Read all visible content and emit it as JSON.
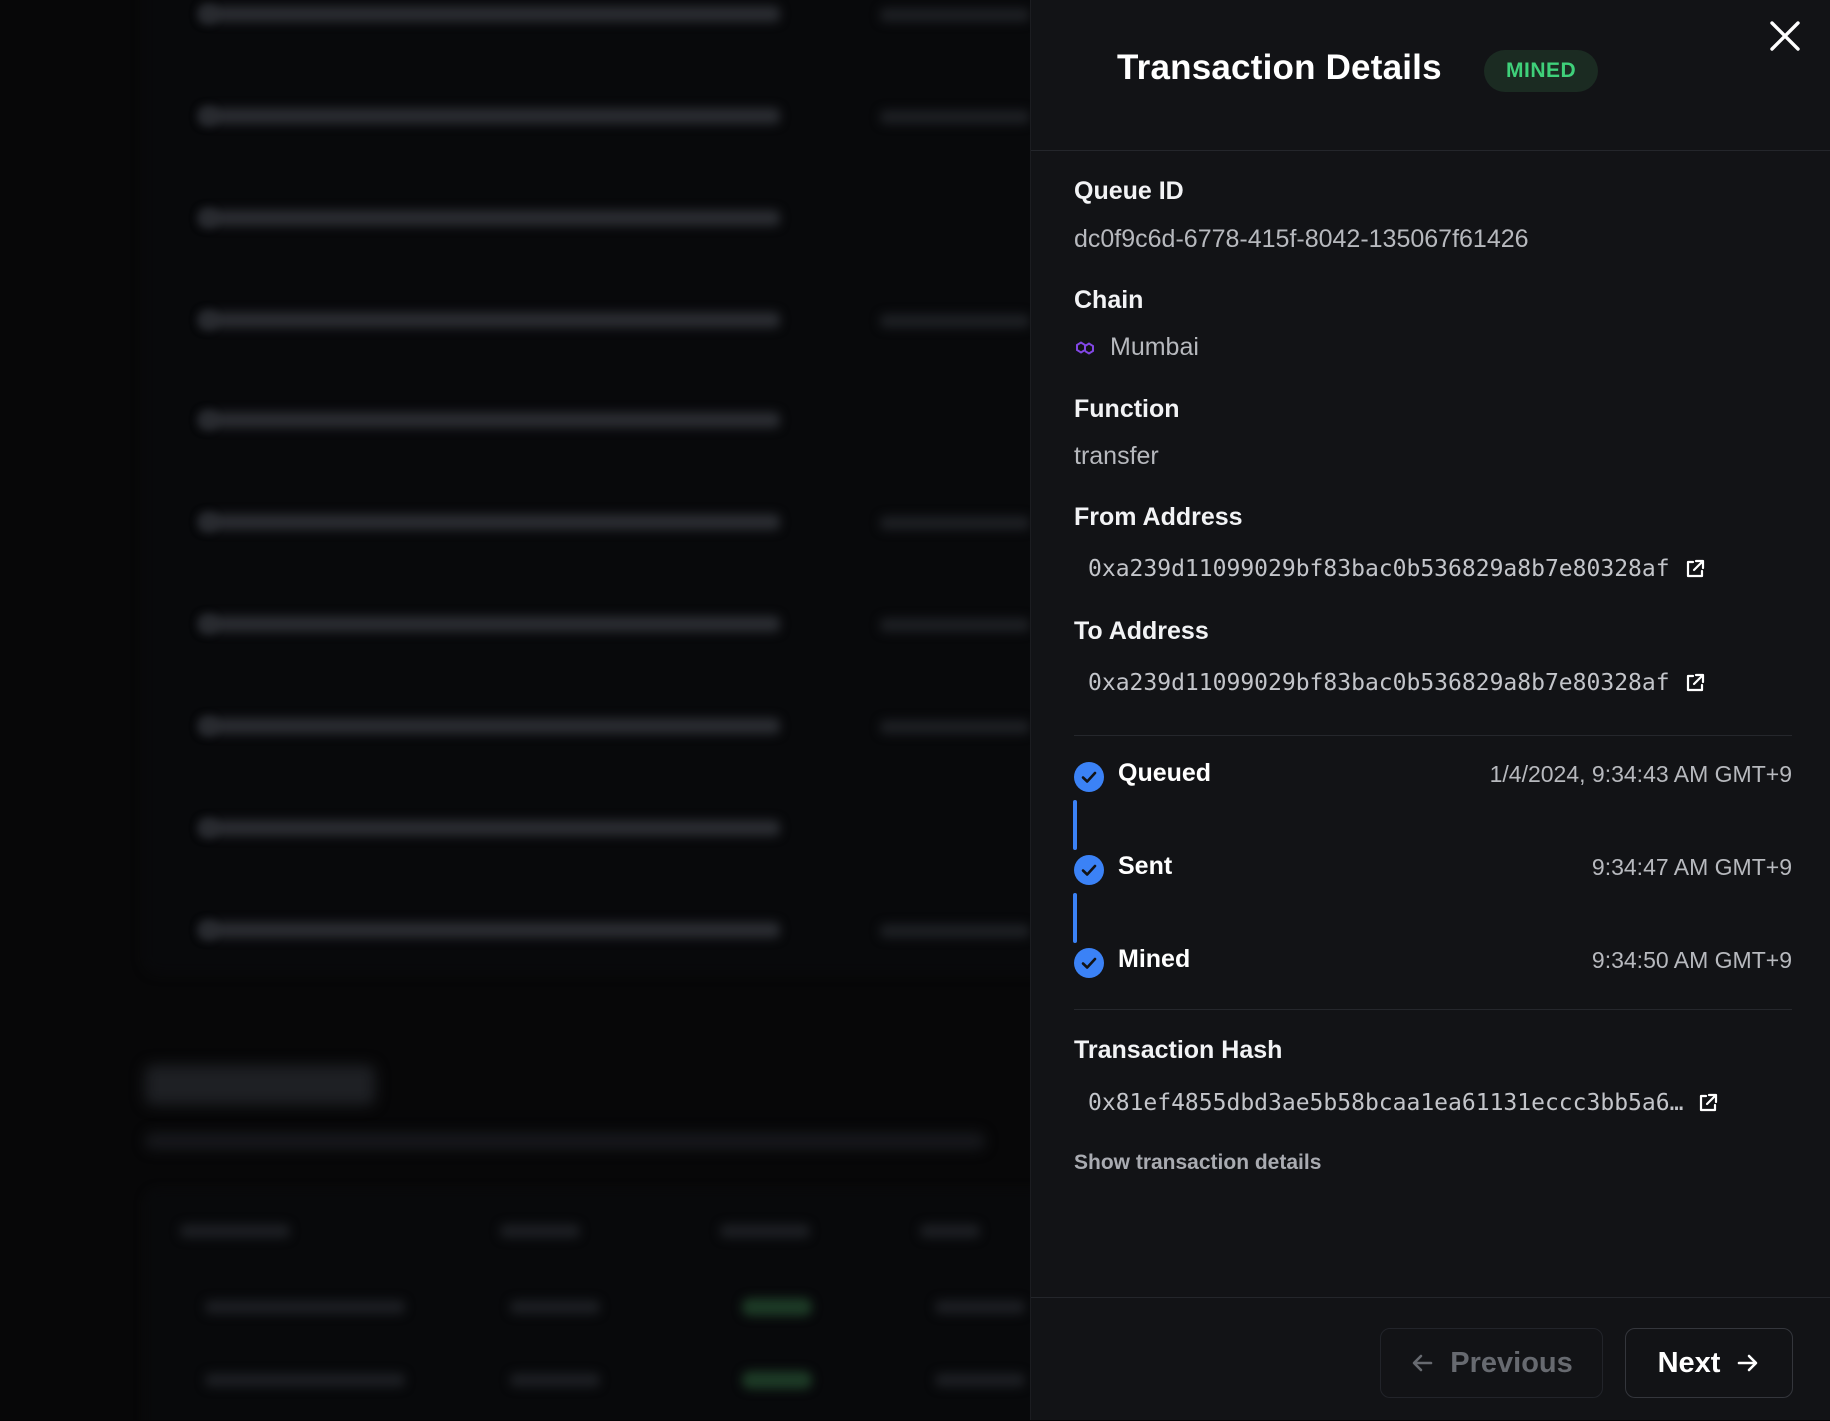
{
  "panel": {
    "title": "Transaction Details",
    "status_badge": "MINED",
    "fields": {
      "queue_id": {
        "label": "Queue ID",
        "value": "dc0f9c6d-6778-415f-8042-135067f61426"
      },
      "chain": {
        "label": "Chain",
        "value": "Mumbai",
        "icon": "polygon-icon"
      },
      "function": {
        "label": "Function",
        "value": "transfer"
      },
      "from_address": {
        "label": "From Address",
        "value": "0xa239d11099029bf83bac0b536829a8b7e80328af"
      },
      "to_address": {
        "label": "To Address",
        "value": "0xa239d11099029bf83bac0b536829a8b7e80328af"
      },
      "transaction_hash": {
        "label": "Transaction Hash",
        "value": "0x81ef4855dbd3ae5b58bcaa1ea61131eccc3bb5a6…"
      }
    },
    "timeline": [
      {
        "label": "Queued",
        "time": "1/4/2024, 9:34:43 AM GMT+9"
      },
      {
        "label": "Sent",
        "time": "9:34:47 AM GMT+9"
      },
      {
        "label": "Mined",
        "time": "9:34:50 AM GMT+9"
      }
    ],
    "show_details_link": "Show transaction details",
    "footer": {
      "previous_label": "Previous",
      "next_label": "Next"
    }
  },
  "colors": {
    "accent": "#3b82f6",
    "badge_text": "#3fd07a",
    "badge_bg": "#1b2b22",
    "panel_bg": "#121316",
    "chain_icon": "#8247e5"
  }
}
